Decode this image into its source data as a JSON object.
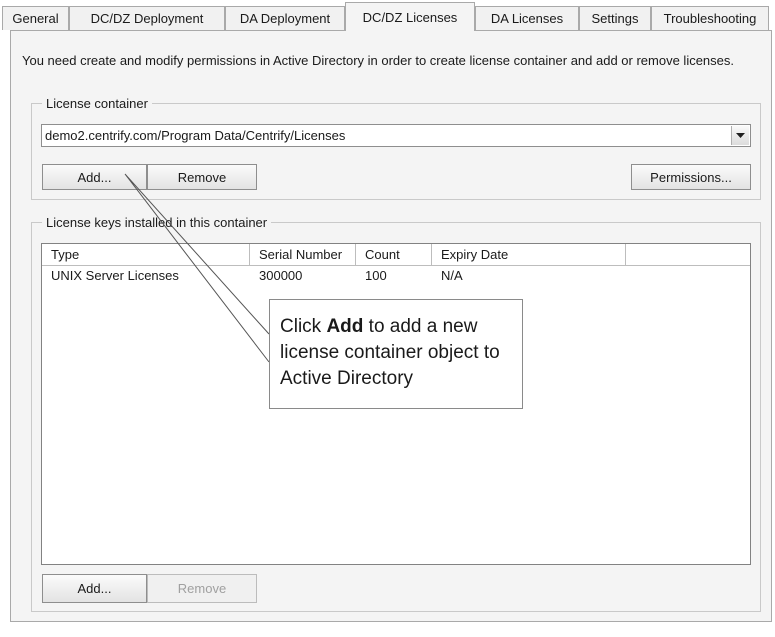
{
  "tabs": [
    {
      "label": "General"
    },
    {
      "label": "DC/DZ Deployment"
    },
    {
      "label": "DA Deployment"
    },
    {
      "label": "DC/DZ Licenses"
    },
    {
      "label": "DA Licenses"
    },
    {
      "label": "Settings"
    },
    {
      "label": "Troubleshooting"
    }
  ],
  "active_tab": "DC/DZ Licenses",
  "intro_text": "You need create and modify permissions in Active Directory in order to create license container and add or remove licenses.",
  "license_container": {
    "legend": "License container",
    "selected": "demo2.centrify.com/Program Data/Centrify/Licenses",
    "add_label": "Add...",
    "remove_label": "Remove",
    "permissions_label": "Permissions..."
  },
  "license_keys": {
    "legend": "License keys installed in this container",
    "columns": [
      "Type",
      "Serial Number",
      "Count",
      "Expiry Date"
    ],
    "rows": [
      {
        "type": "UNIX Server Licenses",
        "serial": "300000",
        "count": "100",
        "expiry": "N/A"
      }
    ],
    "add_label": "Add...",
    "remove_label": "Remove"
  },
  "callout": {
    "before": "Click ",
    "bold": "Add",
    "after": " to add a new license container object to Active Directory"
  }
}
